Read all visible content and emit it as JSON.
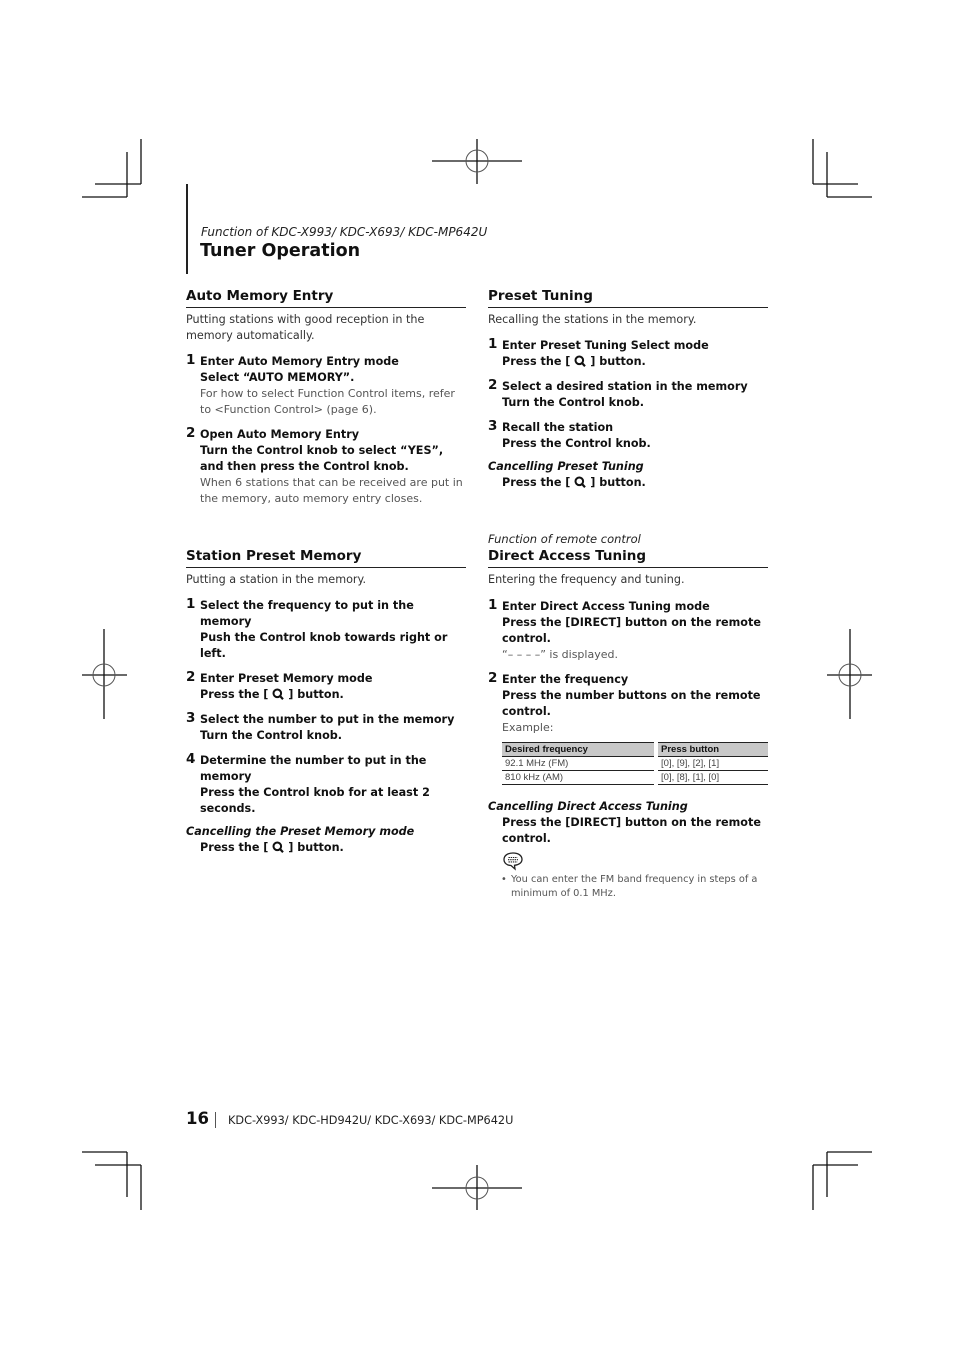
{
  "header": {
    "subtitle": "Function of KDC-X993/ KDC-X693/ KDC-MP642U",
    "title": "Tuner Operation"
  },
  "auto_memory_entry": {
    "title": "Auto Memory Entry",
    "intro": "Putting stations with good reception in the memory automatically.",
    "steps": [
      {
        "number": "1",
        "title": "Enter Auto Memory Entry mode",
        "action": "Select “AUTO MEMORY”.",
        "note": "For how to select Function Control items, refer to <Function Control> (page 6)."
      },
      {
        "number": "2",
        "title": "Open Auto Memory Entry",
        "action": "Turn the Control knob to select “YES”, and then press the Control knob.",
        "note": "When 6 stations that can be received are put in the memory, auto memory entry closes."
      }
    ]
  },
  "preset_tuning": {
    "title": "Preset Tuning",
    "intro": "Recalling the stations in the memory.",
    "steps": [
      {
        "number": "1",
        "title": "Enter Preset Tuning Select mode",
        "action_before": "Press the [ ",
        "icon": "search-q-icon",
        "action_after": " ] button."
      },
      {
        "number": "2",
        "title": "Select a desired station in the memory",
        "action": "Turn the Control knob."
      },
      {
        "number": "3",
        "title": "Recall the station",
        "action": "Press the Control knob."
      }
    ],
    "cancel": {
      "title": "Cancelling Preset Tuning",
      "action_before": "Press the [ ",
      "icon": "search-q-icon",
      "action_after": " ] button."
    }
  },
  "station_preset_memory": {
    "title": "Station Preset Memory",
    "intro": "Putting a station in the memory.",
    "steps": [
      {
        "number": "1",
        "title": "Select the frequency to put in the memory",
        "action": "Push the Control knob towards right or left."
      },
      {
        "number": "2",
        "title": "Enter Preset Memory mode",
        "action_before": "Press the [ ",
        "icon": "search-q-icon",
        "action_after": " ] button."
      },
      {
        "number": "3",
        "title": "Select the number to put in the memory",
        "action": "Turn the Control knob."
      },
      {
        "number": "4",
        "title": "Determine the number to put in the memory",
        "action": "Press the Control knob for at least 2 seconds."
      }
    ],
    "cancel": {
      "title": "Cancelling the Preset Memory mode",
      "action_before": "Press the [ ",
      "icon": "search-q-icon",
      "action_after": " ] button."
    }
  },
  "direct_access_tuning": {
    "subtitle": "Function of remote control",
    "title": "Direct Access Tuning",
    "intro": "Entering the frequency and tuning.",
    "steps": [
      {
        "number": "1",
        "title": "Enter Direct Access Tuning mode",
        "action": "Press the [DIRECT] button on the remote control.",
        "note": "“– – – –” is displayed."
      },
      {
        "number": "2",
        "title": "Enter the frequency",
        "action": "Press the number buttons on the remote control.",
        "note": "Example:"
      }
    ],
    "table": {
      "headers": [
        "Desired frequency",
        "Press button"
      ],
      "rows": [
        [
          "92.1 MHz (FM)",
          "[0], [9], [2], [1]"
        ],
        [
          "810 kHz (AM)",
          "[0], [8], [1], [0]"
        ]
      ]
    },
    "cancel": {
      "title": "Cancelling Direct Access Tuning",
      "action": "Press the [DIRECT] button on the remote control."
    },
    "note": {
      "icon": "speech-bubble-note-icon",
      "bullet": "•",
      "text": "You can enter the FM band frequency in steps of a minimum of 0.1 MHz."
    }
  },
  "footer": {
    "page_number": "16",
    "models": "KDC-X993/ KDC-HD942U/ KDC-X693/ KDC-MP642U"
  }
}
